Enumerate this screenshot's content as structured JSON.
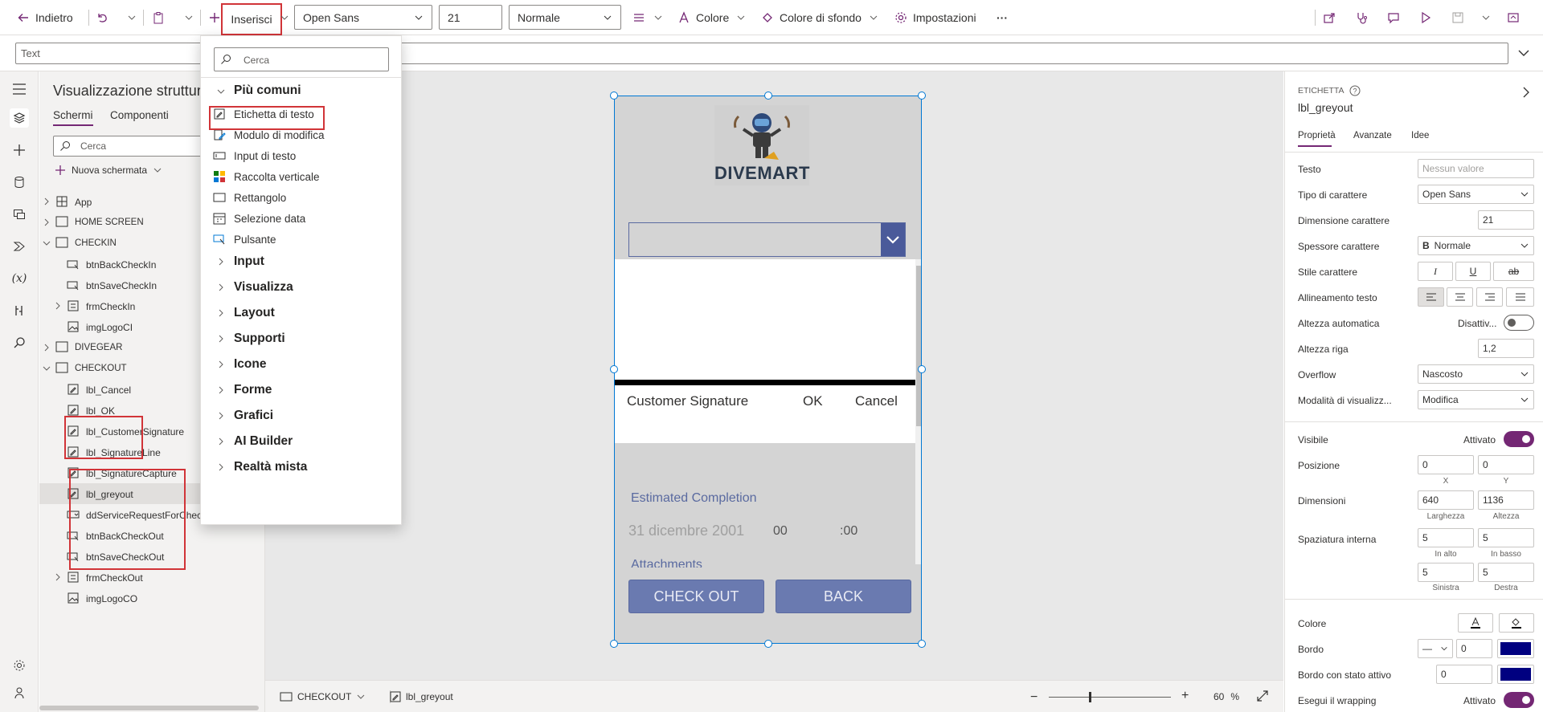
{
  "toolbar": {
    "back_label": "Indietro",
    "insert_label": "Inserisci",
    "font_family": "Open Sans",
    "font_size": "21",
    "font_weight": "Normale",
    "color_label": "Colore",
    "background_label": "Colore di sfondo",
    "settings_label": "Impostazioni",
    "more_label": "···"
  },
  "formula": {
    "property": "Text"
  },
  "tree": {
    "title": "Visualizzazione struttura ad albero",
    "tab_screens": "Schermi",
    "tab_components": "Componenti",
    "search_placeholder": "Cerca",
    "new_screen": "Nuova schermata",
    "items": [
      {
        "label": "App",
        "level": 0,
        "type": "app",
        "expanded": false
      },
      {
        "label": "HOME SCREEN",
        "level": 0,
        "type": "screen",
        "expanded": false
      },
      {
        "label": "CHECKIN",
        "level": 0,
        "type": "screen",
        "expanded": true
      },
      {
        "label": "btnBackCheckIn",
        "level": 1,
        "type": "button"
      },
      {
        "label": "btnSaveCheckIn",
        "level": 1,
        "type": "button"
      },
      {
        "label": "frmCheckIn",
        "level": 1,
        "type": "form",
        "expanded": false
      },
      {
        "label": "imgLogoCI",
        "level": 1,
        "type": "image"
      },
      {
        "label": "DIVEGEAR",
        "level": 0,
        "type": "screen",
        "expanded": false
      },
      {
        "label": "CHECKOUT",
        "level": 0,
        "type": "screen",
        "expanded": true
      },
      {
        "label": "lbl_Cancel",
        "level": 1,
        "type": "label"
      },
      {
        "label": "lbl_OK",
        "level": 1,
        "type": "label"
      },
      {
        "label": "lbl_CustomerSignature",
        "level": 1,
        "type": "label"
      },
      {
        "label": "lbl_SignatureLine",
        "level": 1,
        "type": "label"
      },
      {
        "label": "lbl_SignatureCapture",
        "level": 1,
        "type": "label"
      },
      {
        "label": "lbl_greyout",
        "level": 1,
        "type": "label",
        "selected": true
      },
      {
        "label": "ddServiceRequestForCheckOut",
        "level": 1,
        "type": "dropdown"
      },
      {
        "label": "btnBackCheckOut",
        "level": 1,
        "type": "button"
      },
      {
        "label": "btnSaveCheckOut",
        "level": 1,
        "type": "button"
      },
      {
        "label": "frmCheckOut",
        "level": 1,
        "type": "form",
        "expanded": false
      },
      {
        "label": "imgLogoCO",
        "level": 1,
        "type": "image"
      }
    ]
  },
  "insert_menu": {
    "search_placeholder": "Cerca",
    "section": "Più comuni",
    "common": [
      {
        "label": "Etichetta di testo",
        "icon": "label-icon"
      },
      {
        "label": "Modulo di modifica",
        "icon": "edit-form-icon"
      },
      {
        "label": "Input di testo",
        "icon": "text-input-icon"
      },
      {
        "label": "Raccolta verticale",
        "icon": "gallery-icon"
      },
      {
        "label": "Rettangolo",
        "icon": "rectangle-icon"
      },
      {
        "label": "Selezione data",
        "icon": "calendar-icon"
      },
      {
        "label": "Pulsante",
        "icon": "button-icon"
      }
    ],
    "categories": [
      "Input",
      "Visualizza",
      "Layout",
      "Supporti",
      "Icone",
      "Forme",
      "Grafici",
      "AI Builder",
      "Realtà mista"
    ]
  },
  "phone": {
    "logo_text": "DIVEMART",
    "signature_label": "Customer Signature",
    "ok_label": "OK",
    "cancel_label": "Cancel",
    "estimated_label": "Estimated Completion",
    "date_value": "31 dicembre 2001",
    "hour_value": "00",
    "minute_value": ":00",
    "attachments_label": "Attachments",
    "checkout_button": "CHECK OUT",
    "back_button": "BACK"
  },
  "status": {
    "screen": "CHECKOUT",
    "control": "lbl_greyout",
    "zoom": "60",
    "zoom_unit": "%",
    "zoom_level": 0.6
  },
  "props": {
    "type_label": "ETICHETTA",
    "control_name": "lbl_greyout",
    "tabs": [
      "Proprietà",
      "Avanzate",
      "Idee"
    ],
    "testo_label": "Testo",
    "testo_placeholder": "Nessun valore",
    "font_label": "Tipo di carattere",
    "font_value": "Open Sans",
    "size_label": "Dimensione carattere",
    "size_value": "21",
    "weight_label": "Spessore carattere",
    "weight_value": "Normale",
    "style_label": "Stile carattere",
    "align_label": "Allineamento testo",
    "autoheight_label": "Altezza automatica",
    "autoheight_value": "Disattiv...",
    "lineheight_label": "Altezza riga",
    "lineheight_value": "1,2",
    "overflow_label": "Overflow",
    "overflow_value": "Nascosto",
    "mode_label": "Modalità di visualizz...",
    "mode_value": "Modifica",
    "visible_label": "Visibile",
    "visible_value": "Attivato",
    "position_label": "Posizione",
    "pos_x": "0",
    "pos_y": "0",
    "x_label": "X",
    "y_label": "Y",
    "size2_label": "Dimensioni",
    "width_value": "640",
    "height_value": "1136",
    "width_label": "Larghezza",
    "height_label": "Altezza",
    "padding_label": "Spaziatura interna",
    "pad_top": "5",
    "pad_bottom": "5",
    "pad_left": "5",
    "pad_right": "5",
    "top_label": "In alto",
    "bottom_label": "In basso",
    "left_label": "Sinistra",
    "right_label": "Destra",
    "color_label": "Colore",
    "border_label": "Bordo",
    "border_value": "0",
    "border_active_label": "Bordo con stato attivo",
    "border_active_value": "0",
    "wrap_label": "Esegui il wrapping",
    "wrap_value": "Attivato",
    "accent_color": "#742774",
    "border_color": "#000080"
  }
}
